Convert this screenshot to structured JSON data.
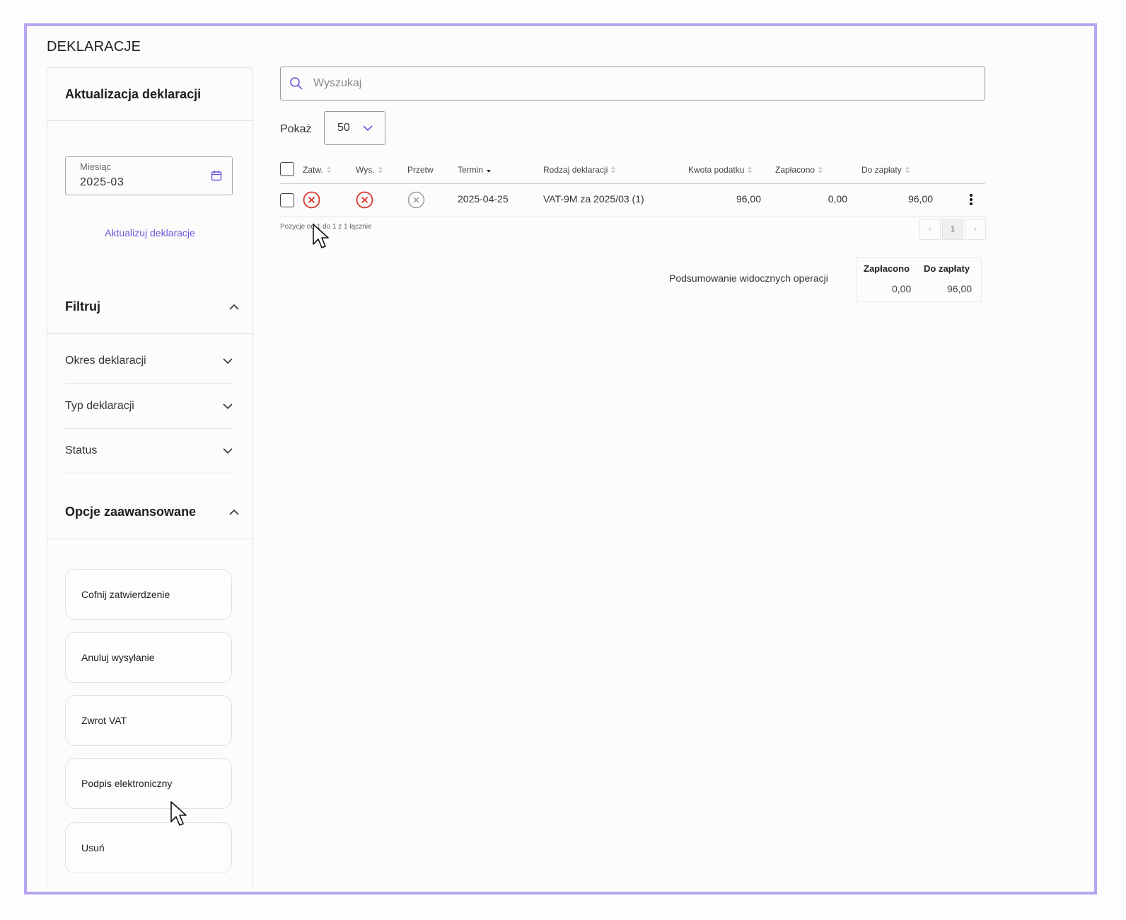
{
  "page": {
    "title": "DEKLARACJE"
  },
  "sidebar": {
    "update_title": "Aktualizacja deklaracji",
    "month_label": "Miesiąc",
    "month_value": "2025-03",
    "update_link": "Aktualizuj deklaracje",
    "filter_title": "Filtruj",
    "filters": [
      {
        "label": "Okres deklaracji"
      },
      {
        "label": "Typ deklaracji"
      },
      {
        "label": "Status"
      }
    ],
    "advanced_title": "Opcje zaawansowane",
    "options": [
      {
        "label": "Cofnij zatwierdzenie"
      },
      {
        "label": "Anuluj wysyłanie"
      },
      {
        "label": "Zwrot VAT"
      },
      {
        "label": "Podpis elektroniczny"
      },
      {
        "label": "Usuń"
      }
    ]
  },
  "search": {
    "placeholder": "Wyszukaj"
  },
  "show": {
    "label": "Pokaż",
    "value": "50"
  },
  "table": {
    "headers": {
      "zatw": "Zatw.",
      "wys": "Wys.",
      "przetw": "Przetw",
      "termin": "Termin",
      "rodzaj": "Rodzaj deklaracji",
      "kwota": "Kwota podatku",
      "zaplacono": "Zapłacono",
      "do_zaplaty": "Do zapłaty"
    },
    "rows": [
      {
        "zatw_status": "not-approved",
        "wys_status": "not-sent",
        "przetw_status": "not-processed",
        "termin": "2025-04-25",
        "rodzaj": "VAT-9M za 2025/03 (1)",
        "kwota": "96,00",
        "zaplacono": "0,00",
        "do_zaplaty": "96,00"
      }
    ],
    "position_info": "Pozycje od 1 do 1 z 1 łącznie",
    "pagination": {
      "current_page": "1",
      "prev": "‹",
      "next": "›"
    }
  },
  "summary": {
    "label": "Podsumowanie widocznych operacji",
    "paid_header": "Zapłacono",
    "due_header": "Do zapłaty",
    "paid_value": "0,00",
    "due_value": "96,00"
  },
  "colors": {
    "frame": "#b7a6ef",
    "accent": "#6a55d8",
    "error": "#d9342b",
    "neutral_icon": "#9a9a9a"
  }
}
